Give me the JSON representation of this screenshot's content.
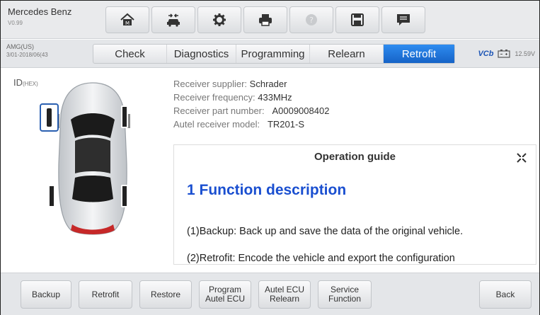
{
  "header": {
    "make": "Mercedes Benz",
    "version": "V0.99",
    "icons": [
      "home-icon",
      "car-icon",
      "settings-icon",
      "print-icon",
      "help-icon",
      "save-icon",
      "message-icon"
    ]
  },
  "system": {
    "line1": "AMG(US)",
    "line2": "3/01-2018/06(43"
  },
  "tabs": [
    {
      "label": "Check",
      "active": false
    },
    {
      "label": "Diagnostics",
      "active": false
    },
    {
      "label": "Programming",
      "active": false
    },
    {
      "label": "Relearn",
      "active": false
    },
    {
      "label": "Retrofit",
      "active": true
    }
  ],
  "status": {
    "vci": "VCb",
    "voltage": "12.59V"
  },
  "sensor_panel": {
    "id_label": "ID",
    "id_suffix": "(HEX)"
  },
  "receiver": {
    "supplier_label": "Receiver supplier:",
    "supplier": "Schrader",
    "frequency_label": "Receiver frequency:",
    "frequency": "433MHz",
    "part_label": "Receiver part number:",
    "part": "A0009008402",
    "model_label": "Autel receiver model:",
    "model": "TR201-S"
  },
  "guide": {
    "title": "Operation guide",
    "heading": "1 Function description",
    "p1": "(1)Backup: Back up and save the data of the original vehicle.",
    "p2": "(2)Retrofit: Encode the vehicle and export the configuration"
  },
  "toolbar": {
    "backup": "Backup",
    "retrofit": "Retrofit",
    "restore": "Restore",
    "program": "Program\nAutel ECU",
    "relearn": "Autel ECU\nRelearn",
    "service": "Service\nFunction",
    "back": "Back"
  },
  "colors": {
    "accent": "#1f74e0",
    "heading": "#1a4fd0",
    "selected_sensor": "#2a5fb0"
  }
}
